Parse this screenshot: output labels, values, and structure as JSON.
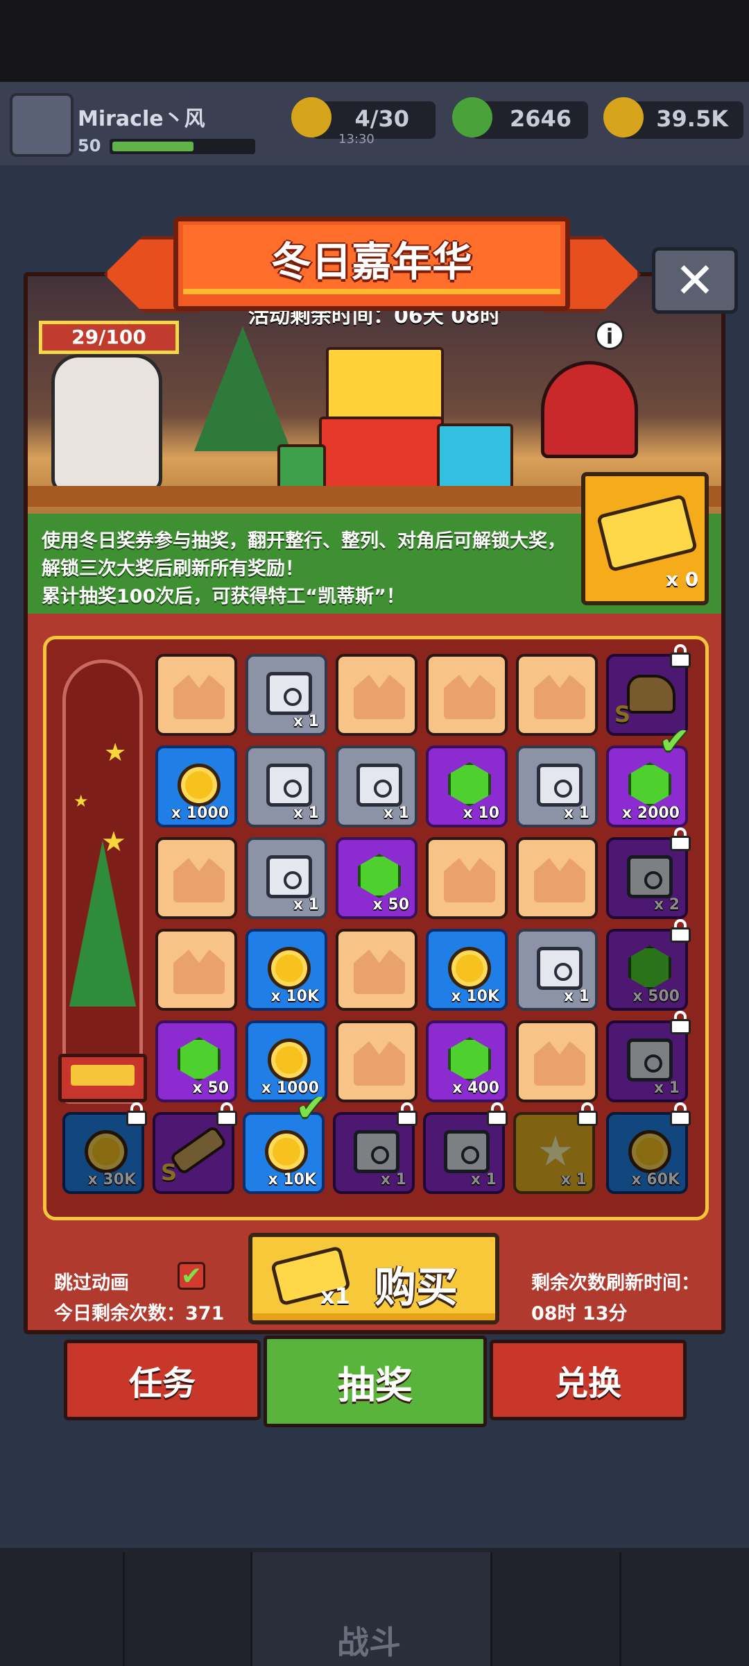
{
  "top_bar": {
    "player_name": "Miracle丶风",
    "level": "50",
    "xp_fraction": 0.58,
    "energy": "4/30",
    "energy_timer": "13:30",
    "gems": "2646",
    "coins": "39.5K"
  },
  "event": {
    "title": "冬日嘉年华",
    "timer_text": "活动剩余时间：06天 08时",
    "progress": "29/100",
    "description_lines": [
      "使用冬日奖券参与抽奖，翻开整行、整列、对角后可解锁大奖，",
      "解锁三次大奖后刷新所有奖励！",
      "累计抽奖100次后，可获得特工“凯蒂斯”！"
    ],
    "ticket_count": "x 0"
  },
  "grid": {
    "rows": [
      [
        {
          "type": "box"
        },
        {
          "type": "chest",
          "color": "gray",
          "amount": "x 1"
        },
        {
          "type": "box"
        },
        {
          "type": "box"
        },
        {
          "type": "box"
        },
        {
          "type": "shoe",
          "color": "purple",
          "locked": true,
          "s": true,
          "amount": ""
        }
      ],
      [
        {
          "type": "coin",
          "color": "blue",
          "amount": "x 1000"
        },
        {
          "type": "chest",
          "color": "gray",
          "amount": "x 1"
        },
        {
          "type": "chest",
          "color": "gray",
          "amount": "x 1"
        },
        {
          "type": "gem",
          "color": "purple",
          "amount": "x 10"
        },
        {
          "type": "chest",
          "color": "gray",
          "amount": "x 1"
        },
        {
          "type": "gem",
          "color": "purple",
          "amount": "x 2000",
          "check": true
        }
      ],
      [
        {
          "type": "box"
        },
        {
          "type": "chest",
          "color": "gray",
          "amount": "x 1"
        },
        {
          "type": "gem",
          "color": "purple",
          "amount": "x 50"
        },
        {
          "type": "box"
        },
        {
          "type": "box"
        },
        {
          "type": "chest",
          "color": "purple",
          "locked": true,
          "amount": "x 2"
        }
      ],
      [
        {
          "type": "box"
        },
        {
          "type": "coin",
          "color": "blue",
          "amount": "x 10K"
        },
        {
          "type": "box"
        },
        {
          "type": "coin",
          "color": "blue",
          "amount": "x 10K"
        },
        {
          "type": "chest",
          "color": "gray",
          "amount": "x 1"
        },
        {
          "type": "gem",
          "color": "purple",
          "locked": true,
          "amount": "x 500"
        }
      ],
      [
        {
          "type": "gem",
          "color": "purple",
          "amount": "x 50"
        },
        {
          "type": "coin",
          "color": "blue",
          "amount": "x 1000"
        },
        {
          "type": "box"
        },
        {
          "type": "gem",
          "color": "purple",
          "amount": "x 400"
        },
        {
          "type": "box"
        },
        {
          "type": "chest",
          "color": "purple",
          "locked": true,
          "amount": "x 1"
        }
      ]
    ],
    "bottom_row": [
      {
        "type": "coin",
        "color": "blue",
        "locked": true,
        "amount": "x 30K"
      },
      {
        "type": "gun",
        "color": "purple",
        "locked": true,
        "s": true,
        "amount": ""
      },
      {
        "type": "coin",
        "color": "blue",
        "amount": "x 10K",
        "check": true
      },
      {
        "type": "chest",
        "color": "purple",
        "locked": true,
        "amount": "x 1"
      },
      {
        "type": "chest",
        "color": "purple",
        "locked": true,
        "amount": "x 1"
      },
      {
        "type": "star",
        "color": "gold",
        "locked": true,
        "amount": "x 1"
      },
      {
        "type": "coin",
        "color": "blue",
        "locked": true,
        "amount": "x 60K"
      }
    ]
  },
  "controls": {
    "skip_label": "跳过动画",
    "remaining_today": "今日剩余次数：371",
    "buy_multiplier": "x1",
    "buy_label": "购买",
    "refresh_label": "剩余次数刷新时间：",
    "refresh_time": "08时 13分"
  },
  "tabs": [
    "任务",
    "抽奖",
    "兑换"
  ],
  "bottom_nav": {
    "battle_label": "战斗"
  },
  "colors": {
    "panel_red": "#b03a2e",
    "board_gold_border": "#f5c63a",
    "tab_active_green": "#58b43a",
    "buy_button_yellow": "#f7c93a"
  }
}
